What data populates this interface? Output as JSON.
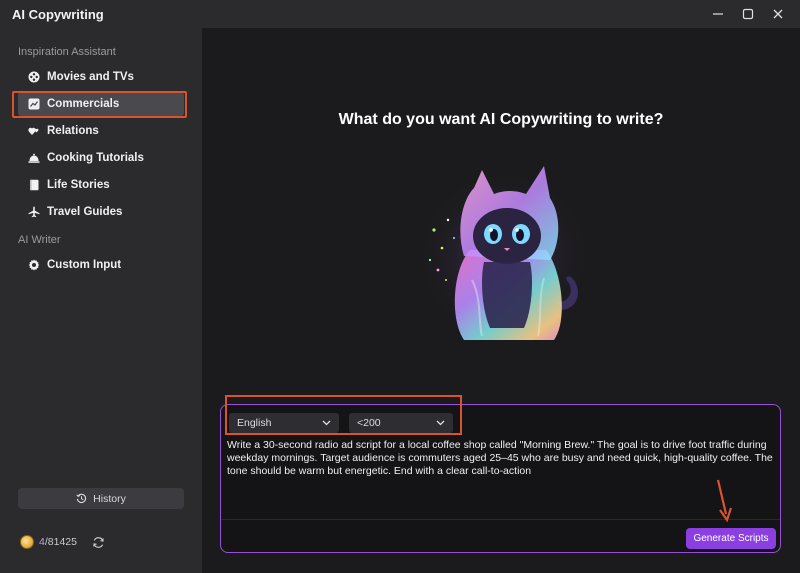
{
  "window": {
    "title": "AI Copywriting"
  },
  "sidebar": {
    "inspiration_label": "Inspiration Assistant",
    "items": [
      {
        "label": "Movies and TVs",
        "icon": "film-reel-icon"
      },
      {
        "label": "Commercials",
        "icon": "chart-icon"
      },
      {
        "label": "Relations",
        "icon": "hearts-icon"
      },
      {
        "label": "Cooking Tutorials",
        "icon": "cloche-icon"
      },
      {
        "label": "Life Stories",
        "icon": "book-icon"
      },
      {
        "label": "Travel Guides",
        "icon": "airplane-icon"
      }
    ],
    "writer_label": "AI Writer",
    "writer_items": [
      {
        "label": "Custom Input",
        "icon": "gear-icon"
      }
    ],
    "history_label": "History",
    "credits": {
      "used": "4",
      "total": "/81425"
    }
  },
  "main": {
    "headline": "What do you want AI Copywriting to write?",
    "language_select": "English",
    "length_select": "<200",
    "prompt": "Write a 30-second radio ad script for a local coffee shop called \"Morning Brew.\" The goal is to drive foot traffic during weekday mornings. Target audience is commuters aged 25–45 who are busy and need quick, high-quality coffee. The tone should be warm but energetic. End with a clear call-to-action",
    "generate_label": "Generate Scripts"
  },
  "colors": {
    "accent": "#8b3fe0",
    "highlight": "#d9532f",
    "panel_border": "#9a4fd6"
  }
}
